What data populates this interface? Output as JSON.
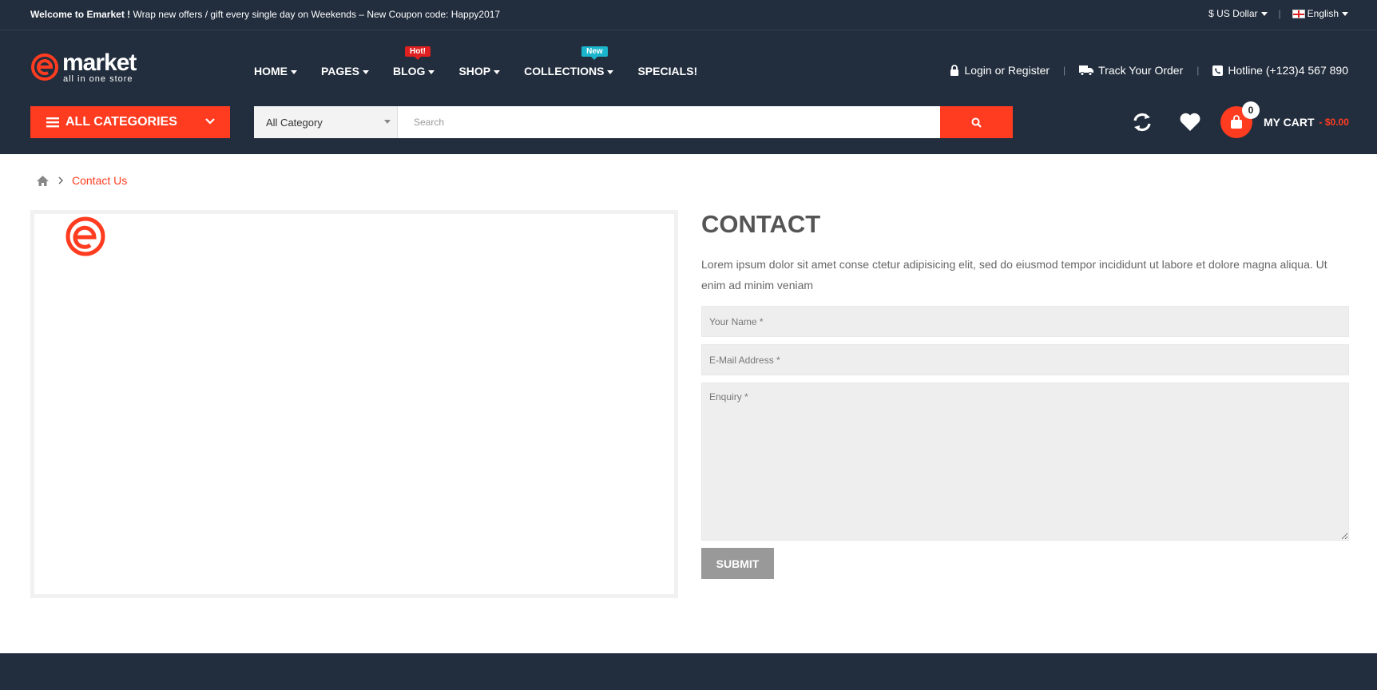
{
  "topbar": {
    "welcome_bold": "Welcome to Emarket !",
    "welcome_text": " Wrap new offers / gift every single day on Weekends – New Coupon code: Happy2017",
    "currency": "$ US Dollar",
    "language": "English"
  },
  "logo": {
    "word": "market",
    "tagline": "all in one store"
  },
  "nav": {
    "items": [
      {
        "label": "HOME"
      },
      {
        "label": "PAGES"
      },
      {
        "label": "BLOG",
        "badge": "Hot!"
      },
      {
        "label": "SHOP"
      },
      {
        "label": "COLLECTIONS",
        "badge": "New"
      },
      {
        "label": "SPECIALS!"
      }
    ]
  },
  "account": {
    "login": "Login or Register",
    "track": "Track Your Order",
    "hotline": "Hotline (+123)4 567 890"
  },
  "categories": {
    "label": "ALL CATEGORIES"
  },
  "search": {
    "category": "All Category",
    "placeholder": "Search"
  },
  "cart": {
    "count": "0",
    "label": "MY CART",
    "total": "- $0.00"
  },
  "breadcrumb": {
    "current": "Contact Us"
  },
  "contact": {
    "title": "CONTACT",
    "description": "Lorem ipsum dolor sit amet conse ctetur adipisicing elit, sed do eiusmod tempor incididunt ut labore et dolore magna aliqua. Ut enim ad minim veniam",
    "name_placeholder": "Your Name *",
    "email_placeholder": "E-Mail Address *",
    "enquiry_placeholder": "Enquiry *",
    "submit_label": "SUBMIT"
  },
  "colors": {
    "accent": "#ff3c20",
    "dark": "#222d3d",
    "hot": "#e02020",
    "new": "#1ab5cc"
  }
}
